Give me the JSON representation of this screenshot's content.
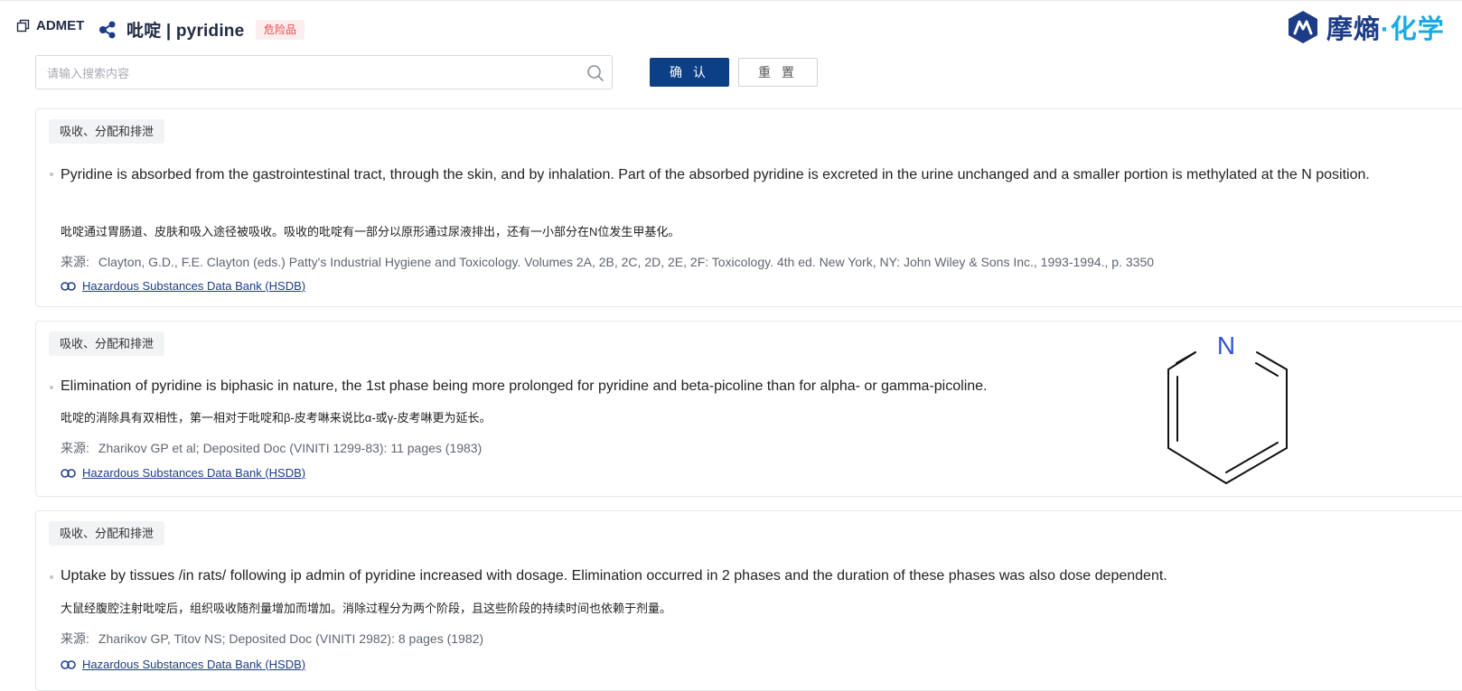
{
  "header": {
    "module": "ADMET",
    "compound": "吡啶 | pyridine",
    "hazard_badge": "危险品",
    "brand_main": "摩熵",
    "brand_dot": "·",
    "brand_accent": "化学"
  },
  "search": {
    "placeholder": "请输入搜索内容",
    "value": "",
    "confirm_label": "确 认",
    "reset_label": "重 置"
  },
  "records": [
    {
      "tag": "吸收、分配和排泄",
      "en": "Pyridine is absorbed from the gastrointestinal tract, through the skin, and by inhalation. Part of the absorbed pyridine is excreted in the urine unchanged and a smaller portion is methylated at the N position.",
      "zh": "吡啶通过胃肠道、皮肤和吸入途径被吸收。吸收的吡啶有一部分以原形通过尿液排出，还有一小部分在N位发生甲基化。",
      "source_label": "来源:",
      "source": "Clayton, G.D., F.E. Clayton (eds.) Patty's Industrial Hygiene and Toxicology. Volumes 2A, 2B, 2C, 2D, 2E, 2F: Toxicology. 4th ed. New York, NY: John Wiley & Sons Inc., 1993-1994., p. 3350",
      "link": "Hazardous Substances Data Bank (HSDB)"
    },
    {
      "tag": "吸收、分配和排泄",
      "en": "Elimination of pyridine is biphasic in nature, the 1st phase being more prolonged for pyridine and beta-picoline than for alpha- or gamma-picoline.",
      "zh": "吡啶的消除具有双相性，第一相对于吡啶和β-皮考啉来说比α-或γ-皮考啉更为延长。",
      "source_label": "来源:",
      "source": "Zharikov GP et al; Deposited Doc (VINITI 1299-83): 11 pages (1983)",
      "link": "Hazardous Substances Data Bank (HSDB)"
    },
    {
      "tag": "吸收、分配和排泄",
      "en": "Uptake by tissues /in rats/ following ip admin of pyridine increased with dosage. Elimination occurred in 2 phases and the duration of these phases was also dose dependent.",
      "zh": "大鼠经腹腔注射吡啶后，组织吸收随剂量增加而增加。消除过程分为两个阶段，且这些阶段的持续时间也依赖于剂量。",
      "source_label": "来源:",
      "source": "Zharikov GP, Titov NS; Deposited Doc (VINITI 2982): 8 pages (1982)",
      "link": "Hazardous Substances Data Bank (HSDB)"
    }
  ],
  "structure": {
    "atom_label": "N",
    "atom_color": "#2f55d4"
  },
  "colors": {
    "primary": "#0d3f86",
    "brand_blue": "#1c3c86",
    "brand_cyan": "#1aa9e1",
    "danger": "#e5484d"
  }
}
